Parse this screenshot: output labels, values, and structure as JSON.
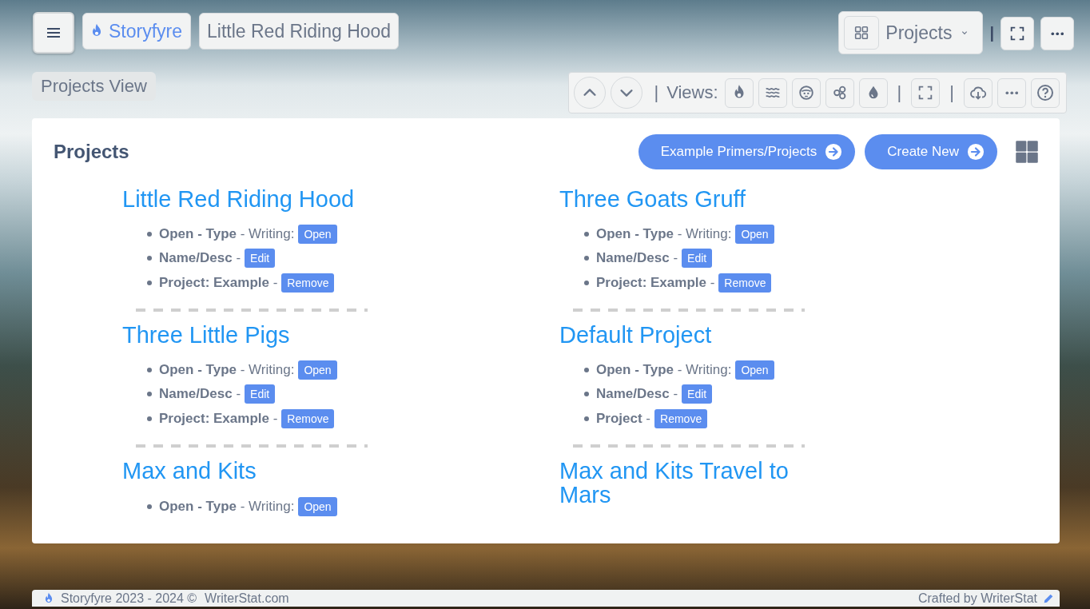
{
  "header": {
    "brand": "Storyfyre",
    "project_title": "Little Red Riding Hood",
    "view_label": "Projects View",
    "view_menu": {
      "label": "Projects"
    },
    "divider": "|"
  },
  "view_toolbar": {
    "divider_1": "|",
    "label": "Views:",
    "divider_2": "|",
    "divider_3": "|"
  },
  "panel": {
    "title": "Projects",
    "buttons": [
      "Example Primers/Projects",
      "Create New"
    ],
    "projects": [
      {
        "title": "Little Red Riding Hood",
        "rows": [
          {
            "text": "**Open - Type** - Writing:",
            "button": "Open"
          },
          {
            "text": "**Name/Desc** -",
            "button": "Edit"
          },
          {
            "text": "**Project: Example** -",
            "button": "Remove"
          }
        ]
      },
      {
        "title": "Three Goats Gruff",
        "rows": [
          {
            "text": "**Open - Type** - Writing:",
            "button": "Open"
          },
          {
            "text": "**Name/Desc** -",
            "button": "Edit"
          },
          {
            "text": "**Project: Example** -",
            "button": "Remove"
          }
        ]
      },
      {
        "title": "Three Little Pigs",
        "rows": [
          {
            "text": "**Open - Type** - Writing:",
            "button": "Open"
          },
          {
            "text": "**Name/Desc** -",
            "button": "Edit"
          },
          {
            "text": "**Project: Example** -",
            "button": "Remove"
          }
        ]
      },
      {
        "title": "Default Project",
        "rows": [
          {
            "text": "**Open - Type** - Writing:",
            "button": "Open"
          },
          {
            "text": "**Name/Desc** -",
            "button": "Edit"
          },
          {
            "text": "**Project** -",
            "button": "Remove"
          }
        ]
      },
      {
        "title": "Max and Kits",
        "rows": [
          {
            "text": "**Open - Type** - Writing:",
            "button": "Open"
          }
        ]
      },
      {
        "title": "Max and Kits Travel to Mars"
      }
    ]
  },
  "footer": {
    "left": "Storyfyre 2023 - 2024 ©",
    "link": "WriterStat.com",
    "right": "Crafted by WriterStat"
  }
}
